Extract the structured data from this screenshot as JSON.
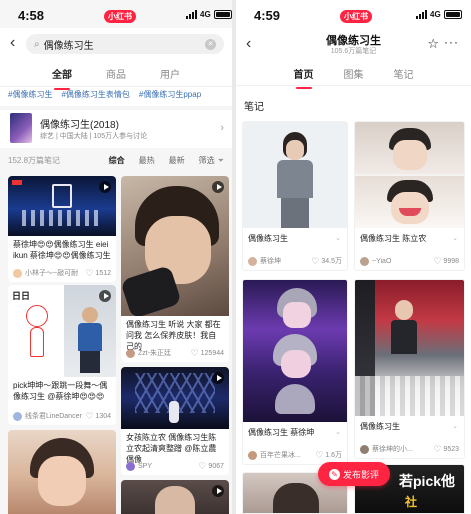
{
  "left": {
    "status": {
      "time": "4:58",
      "app_name": "小红书",
      "network": "4G"
    },
    "search": {
      "value": "偶像练习生"
    },
    "tabs": [
      "全部",
      "商品",
      "用户"
    ],
    "hashtags": [
      "#偶像练习生",
      "#偶像练习生表情包",
      "#偶像练习生ppap"
    ],
    "show": {
      "title": "偶像练习生(2018)",
      "meta": "综艺 | 中国大陆 | 105万人参与讨论"
    },
    "filters": {
      "count": "152.8万篇笔记",
      "options": [
        "综合",
        "最热",
        "最新",
        "筛选"
      ]
    },
    "cards": [
      {
        "title": "蔡徐坤😍😍偶像练习生 eiei ikun 蔡徐坤😍😍偶像练习生",
        "author": "小林子〜~敲可耐",
        "likes": "1512"
      },
      {
        "title": "偶像练习生 听说 大家 都在问我 怎么保养皮肤！我自己的",
        "author": "Zzt-朱正廷",
        "likes": "125944"
      },
      {
        "title": "pick坤坤〜跟跳一段舞〜偶像练习生 @蔡徐坤😍😍😍",
        "author": "线条君LineDancer",
        "likes": "1304"
      },
      {
        "title": "女孩陈立农 偶像练习生陈立农起清爽整蹭 @陈立農 偶像",
        "author": "SPY",
        "likes": "9067"
      }
    ],
    "card_overlay": "日日"
  },
  "right": {
    "status": {
      "time": "4:59",
      "app_name": "小红书",
      "network": "4G"
    },
    "header": {
      "title": "偶像练习生",
      "subtitle": "105.6万篇笔记"
    },
    "tabs": [
      "首页",
      "图集",
      "笔记"
    ],
    "section": "笔记",
    "cards": [
      {
        "title": "偶像练习生",
        "author": "蔡徐坤",
        "likes": "34.5万"
      },
      {
        "title": "偶像练习生 陈立农",
        "author": "~YiaO",
        "likes": "9998"
      },
      {
        "title": "偶像练习生 蔡徐坤",
        "author": "百年芒果冰...",
        "likes": "1.6万"
      },
      {
        "title": "偶像练习生",
        "author": "蔡徐坤的小...",
        "likes": "9523"
      }
    ],
    "bottom_banner": "若pick他",
    "bottom_banner2": "社",
    "publish_button": "发布影评"
  },
  "colors": {
    "brand": "#ff2442",
    "link": "#3a6fb3"
  }
}
